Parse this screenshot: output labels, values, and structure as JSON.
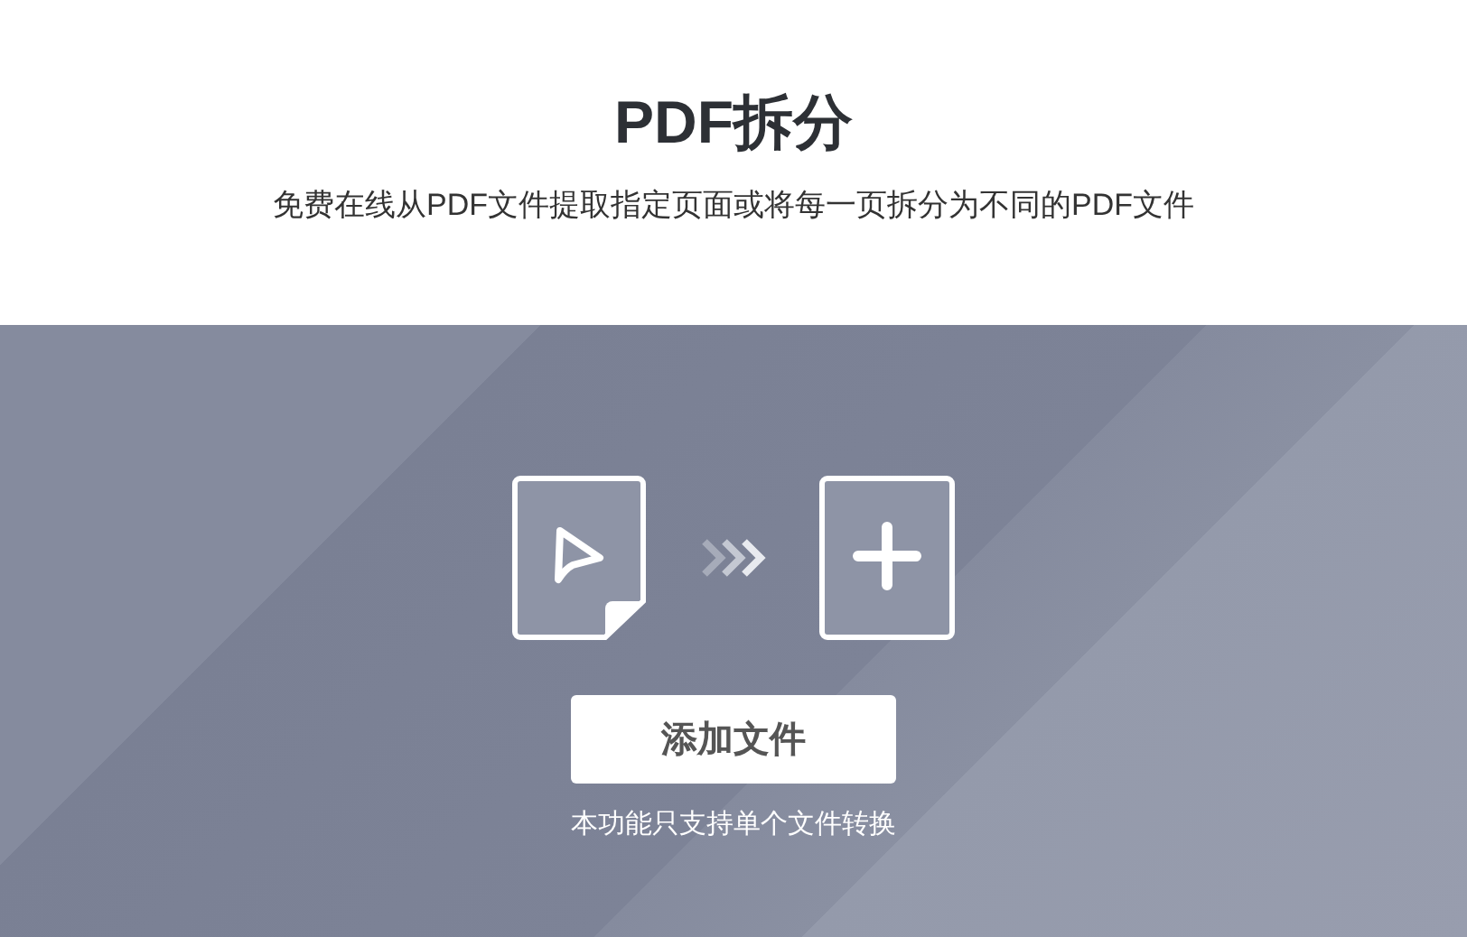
{
  "header": {
    "title": "PDF拆分",
    "subtitle": "免费在线从PDF文件提取指定页面或将每一页拆分为不同的PDF文件"
  },
  "upload": {
    "button": "添加文件",
    "note": "本功能只支持单个文件转换"
  }
}
